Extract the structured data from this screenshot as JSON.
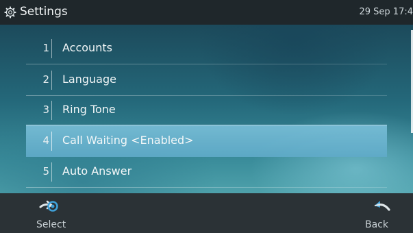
{
  "status_bar": {
    "title": "Settings",
    "clock": "29 Sep 17:4",
    "icon": "gear-icon"
  },
  "menu": {
    "items": [
      {
        "number": "1",
        "label": "Accounts",
        "selected": false
      },
      {
        "number": "2",
        "label": "Language",
        "selected": false
      },
      {
        "number": "3",
        "label": "Ring Tone",
        "selected": false
      },
      {
        "number": "4",
        "label": "Call Waiting <Enabled>",
        "selected": true
      },
      {
        "number": "5",
        "label": "Auto Answer",
        "selected": false
      }
    ]
  },
  "softkeys": {
    "select": {
      "label": "Select",
      "icon": "select-arrow-icon"
    },
    "back": {
      "label": "Back",
      "icon": "back-arrow-icon"
    }
  },
  "colors": {
    "accent_icon": "#3fa0d8",
    "selected_row": "#6ab4d2",
    "status_bar_bg": "#1f272b",
    "softkey_bg": "#2b3236"
  }
}
